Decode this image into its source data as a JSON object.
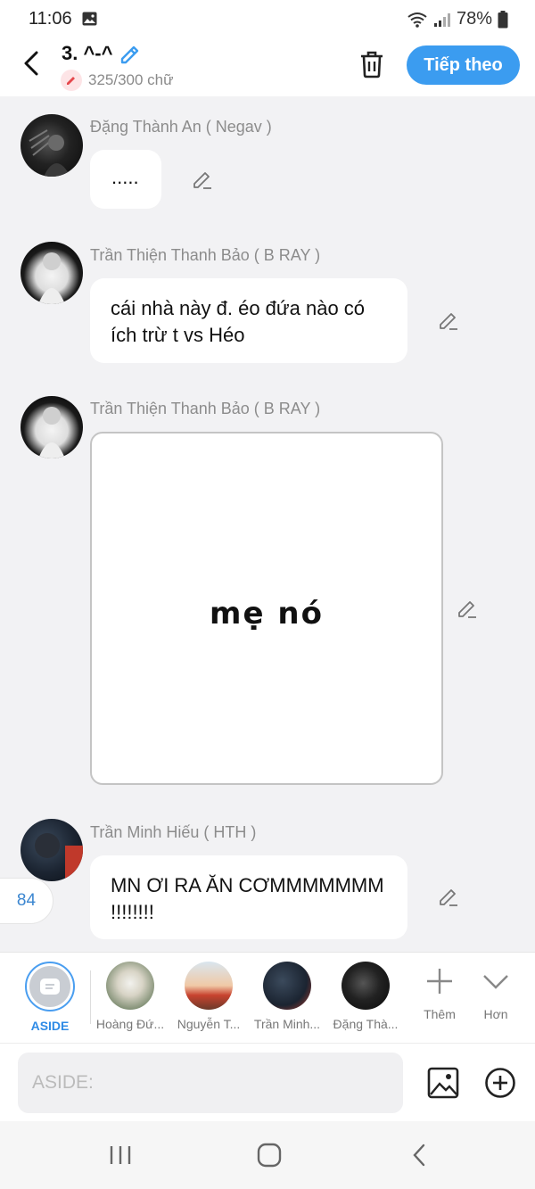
{
  "status": {
    "time": "11:06",
    "battery": "78%"
  },
  "header": {
    "title": "3. ^-^",
    "count": "325/300 chữ",
    "next_label": "Tiếp theo"
  },
  "messages": [
    {
      "sender": "Đặng Thành An ( Negav )",
      "text": "....."
    },
    {
      "sender": "Trần Thiện Thanh Bảo ( B RAY )",
      "text": "cái nhà này đ. éo đứa nào có ích trừ t vs Héo"
    },
    {
      "sender": "Trần Thiện Thanh Bảo ( B RAY )",
      "image_text": "mẹ nó"
    },
    {
      "sender": "Trần Minh Hiếu ( HTH )",
      "text": "MN ƠI RA ĂN CƠMMMMMMM !!!!!!!!"
    }
  ],
  "counter": "84",
  "characters": [
    {
      "label": "ASIDE"
    },
    {
      "label": "Hoàng Đứ..."
    },
    {
      "label": "Nguyễn T..."
    },
    {
      "label": "Trần Minh..."
    },
    {
      "label": "Đặng Thà..."
    }
  ],
  "actions": {
    "more": "Thêm",
    "expand": "Hơn"
  },
  "input": {
    "placeholder": "ASIDE:"
  },
  "colors": {
    "accent": "#3b9cf0",
    "aside_label": "#2f8be6",
    "background": "#f2f2f4"
  }
}
